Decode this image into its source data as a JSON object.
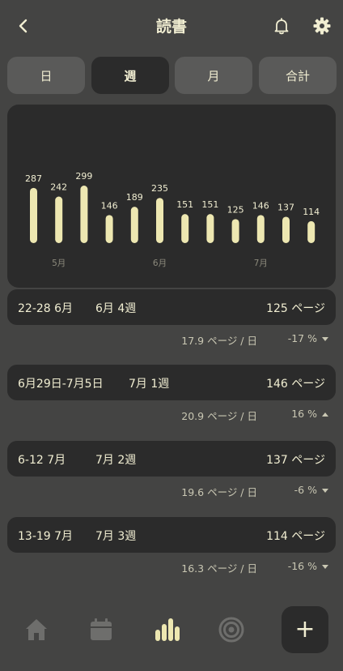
{
  "header": {
    "title": "読書"
  },
  "tabs": [
    {
      "label": "日",
      "active": false
    },
    {
      "label": "週",
      "active": true
    },
    {
      "label": "月",
      "active": false
    },
    {
      "label": "合計",
      "active": false
    }
  ],
  "chart_data": {
    "type": "bar",
    "categories": [
      "",
      "",
      "",
      "",
      "",
      "",
      "",
      "",
      "",
      "",
      "",
      ""
    ],
    "values": [
      287,
      242,
      299,
      146,
      189,
      235,
      151,
      151,
      125,
      146,
      137,
      114
    ],
    "month_labels": [
      {
        "index": 1,
        "label": "5月"
      },
      {
        "index": 5,
        "label": "6月"
      },
      {
        "index": 9,
        "label": "7月"
      }
    ],
    "bar_color": "#ede7b1"
  },
  "weeks": [
    {
      "range": "22-28 6月",
      "week": "6月 4週",
      "pages": "125 ページ",
      "rate": "17.9 ページ / 日",
      "pct": "-17 %",
      "dir": "down"
    },
    {
      "range": "6月29日-7月5日",
      "week": "7月 1週",
      "pages": "146 ページ",
      "rate": "20.9 ページ / 日",
      "pct": "16 %",
      "dir": "up"
    },
    {
      "range": "6-12 7月",
      "week": "7月 2週",
      "pages": "137 ページ",
      "rate": "19.6 ページ / 日",
      "pct": "-6 %",
      "dir": "down"
    },
    {
      "range": "13-19 7月",
      "week": "7月 3週",
      "pages": "114 ページ",
      "rate": "16.3 ページ / 日",
      "pct": "-16 %",
      "dir": "down"
    }
  ],
  "bottom_nav": {
    "fab_label": "+",
    "icons": [
      "home-icon",
      "calendar-icon",
      "stats-icon",
      "target-icon"
    ]
  }
}
